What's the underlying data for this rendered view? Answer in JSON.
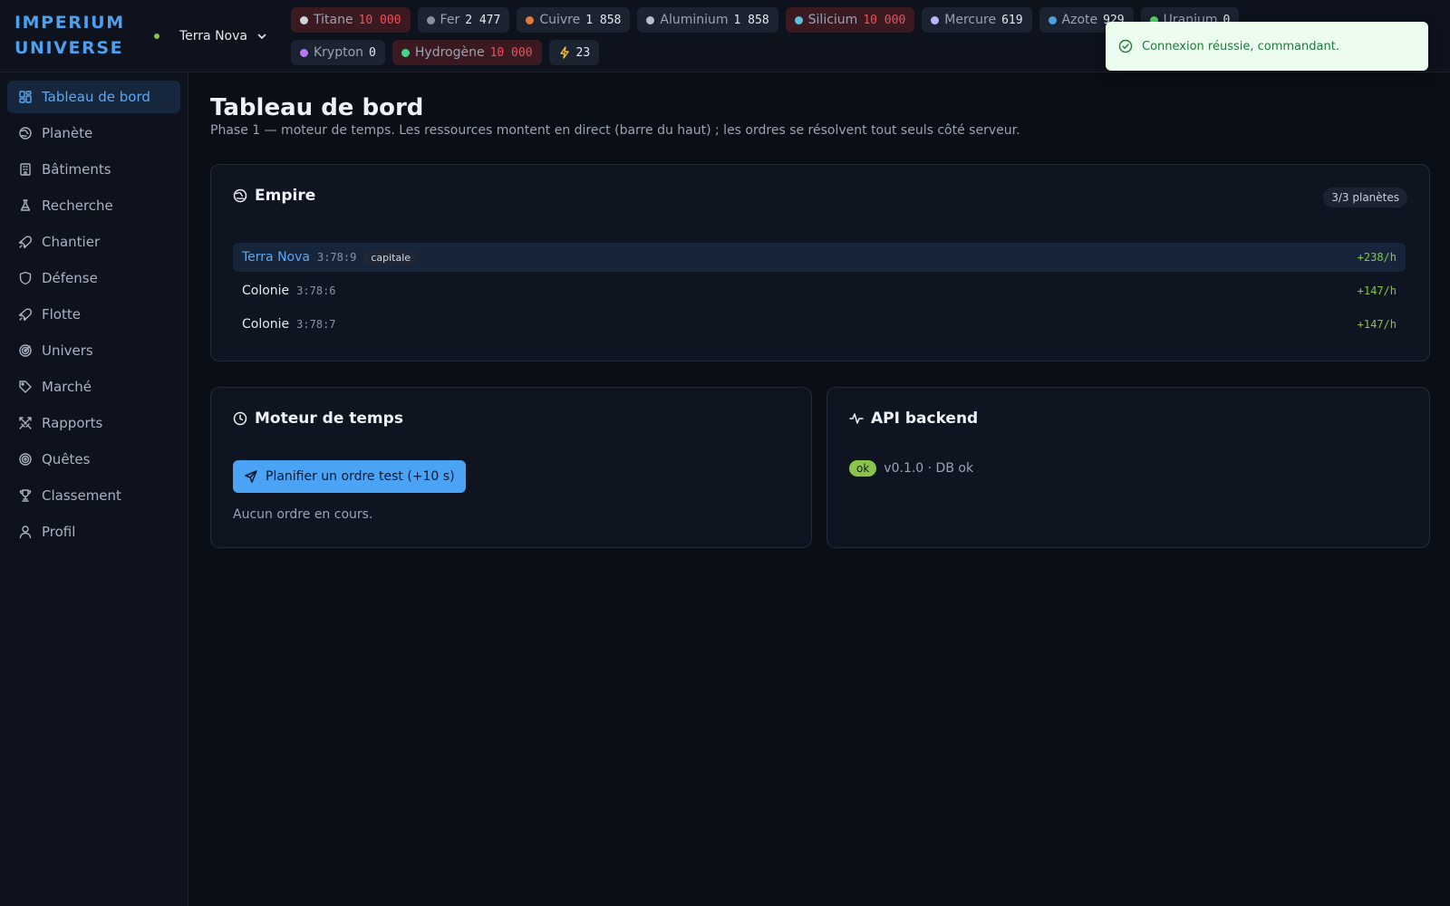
{
  "app": {
    "logo_line1": "IMPERIUM",
    "logo_line2": "UNIVERSE"
  },
  "planet_selector": {
    "current": "Terra Nova",
    "status_color": "#8bc34a"
  },
  "resources": [
    {
      "name": "Titane",
      "value": "10 000",
      "color": "#d0d4da",
      "capped": true
    },
    {
      "name": "Fer",
      "value": "2 477",
      "color": "#8a8f98",
      "capped": false
    },
    {
      "name": "Cuivre",
      "value": "1 858",
      "color": "#e07a3f",
      "capped": false
    },
    {
      "name": "Aluminium",
      "value": "1 858",
      "color": "#b8bec8",
      "capped": false
    },
    {
      "name": "Silicium",
      "value": "10 000",
      "color": "#5bc0de",
      "capped": true
    },
    {
      "name": "Mercure",
      "value": "619",
      "color": "#b9b6ff",
      "capped": false
    },
    {
      "name": "Azote",
      "value": "929",
      "color": "#4d9fdf",
      "capped": false
    },
    {
      "name": "Uranium",
      "value": "0",
      "color": "#4cd964",
      "capped": false
    },
    {
      "name": "Krypton",
      "value": "0",
      "color": "#b57bee",
      "capped": false
    },
    {
      "name": "Hydrogène",
      "value": "10 000",
      "color": "#3ed68a",
      "capped": true
    }
  ],
  "energy": {
    "value": "23"
  },
  "toast": {
    "message": "Connexion réussie, commandant."
  },
  "sidebar": {
    "items": [
      {
        "label": "Tableau de bord",
        "icon": "dashboard-icon",
        "active": true
      },
      {
        "label": "Planète",
        "icon": "globe-icon",
        "active": false
      },
      {
        "label": "Bâtiments",
        "icon": "building-icon",
        "active": false
      },
      {
        "label": "Recherche",
        "icon": "flask-icon",
        "active": false
      },
      {
        "label": "Chantier",
        "icon": "rocket-icon",
        "active": false
      },
      {
        "label": "Défense",
        "icon": "shield-icon",
        "active": false
      },
      {
        "label": "Flotte",
        "icon": "rocket-icon",
        "active": false
      },
      {
        "label": "Univers",
        "icon": "radar-icon",
        "active": false
      },
      {
        "label": "Marché",
        "icon": "tag-icon",
        "active": false
      },
      {
        "label": "Rapports",
        "icon": "swords-icon",
        "active": false
      },
      {
        "label": "Quêtes",
        "icon": "target-icon",
        "active": false
      },
      {
        "label": "Classement",
        "icon": "trophy-icon",
        "active": false
      },
      {
        "label": "Profil",
        "icon": "user-icon",
        "active": false
      }
    ]
  },
  "main": {
    "title": "Tableau de bord",
    "subtitle": "Phase 1 — moteur de temps. Les ressources montent en direct (barre du haut) ; les ordres se résolvent tout seuls côté serveur."
  },
  "empire": {
    "title": "Empire",
    "count_badge": "3/3 planètes",
    "planets": [
      {
        "name": "Terra Nova",
        "coords": "3:78:9",
        "tag": "capitale",
        "rate": "+238/h",
        "active": true
      },
      {
        "name": "Colonie",
        "coords": "3:78:6",
        "tag": "",
        "rate": "+147/h",
        "active": false
      },
      {
        "name": "Colonie",
        "coords": "3:78:7",
        "tag": "",
        "rate": "+147/h",
        "active": false
      }
    ]
  },
  "time_engine": {
    "title": "Moteur de temps",
    "button_label": "Planifier un ordre test (+10 s)",
    "empty_text": "Aucun ordre en cours."
  },
  "api": {
    "title": "API backend",
    "status": "ok",
    "version_text": "v0.1.0 · DB ok"
  }
}
